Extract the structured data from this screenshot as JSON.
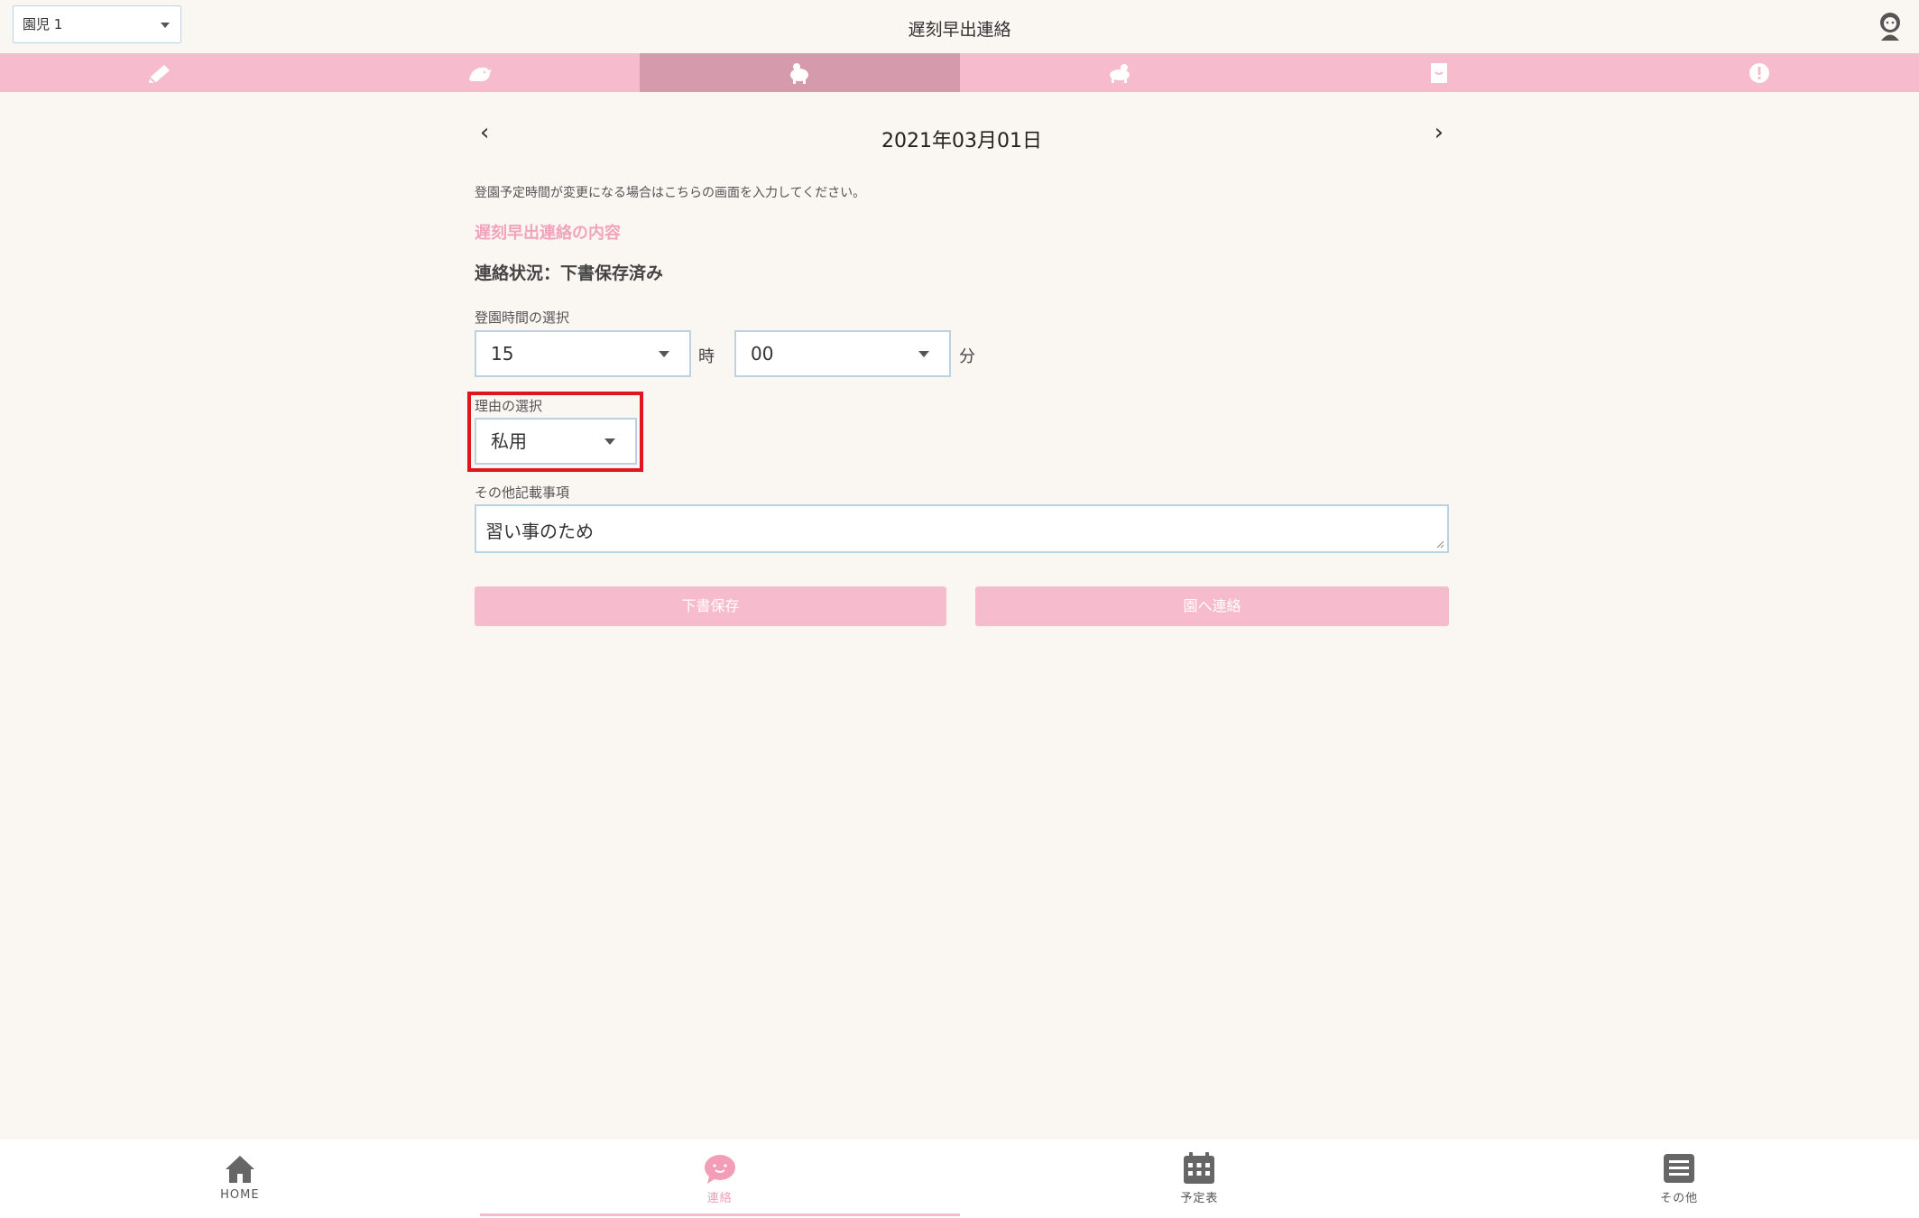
{
  "header": {
    "child_select": "園児 1",
    "title": "遅刻早出連絡"
  },
  "tabs": [
    {
      "icon": "pencil-icon",
      "active": false
    },
    {
      "icon": "bird-icon",
      "active": false
    },
    {
      "icon": "walking-animal-icon",
      "active": true
    },
    {
      "icon": "running-animal-icon",
      "active": false
    },
    {
      "icon": "calendar-page-icon",
      "active": false
    },
    {
      "icon": "alert-bubble-icon",
      "active": false
    }
  ],
  "date": {
    "prev": "‹",
    "value": "2021年03月01日",
    "next": "›"
  },
  "form": {
    "notice": "登園予定時間が変更になる場合はこちらの画面を入力してください。",
    "section_title": "遅刻早出連絡の内容",
    "status": "連絡状況：下書保存済み",
    "time_label": "登園時間の選択",
    "hour_value": "15",
    "hour_unit": "時",
    "minute_value": "00",
    "minute_unit": "分",
    "reason_label": "理由の選択",
    "reason_value": "私用",
    "notes_label": "その他記載事項",
    "notes_value": "習い事のため",
    "draft_button": "下書保存",
    "send_button": "園へ連絡"
  },
  "bottom_nav": [
    {
      "label": "HOME",
      "icon": "home-icon",
      "active": false
    },
    {
      "label": "連絡",
      "icon": "chat-face-icon",
      "active": true
    },
    {
      "label": "予定表",
      "icon": "calendar-icon",
      "active": false
    },
    {
      "label": "その他",
      "icon": "menu-list-icon",
      "active": false
    }
  ],
  "colors": {
    "accent_pink": "#f6bccd",
    "active_tab": "#d59aac",
    "highlight_red": "#e0161e",
    "section_title": "#f2a4bd"
  }
}
